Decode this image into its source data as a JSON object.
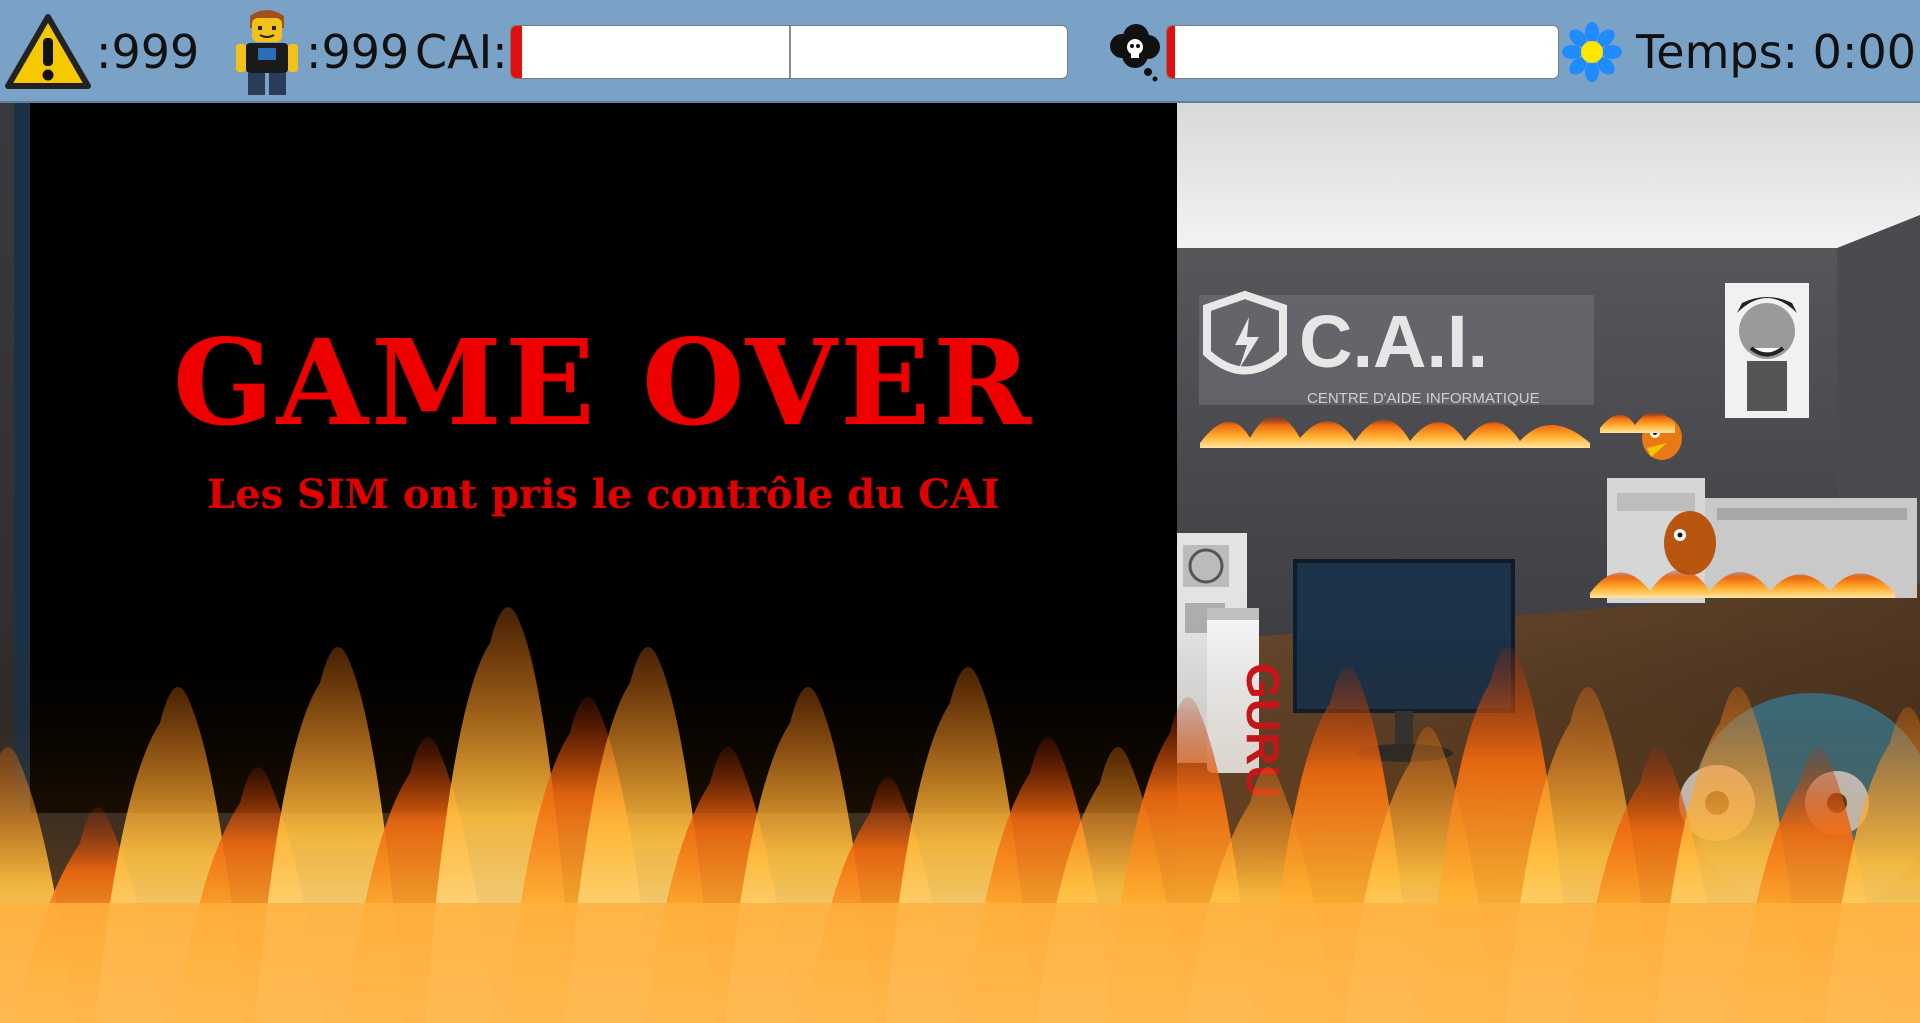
{
  "hud": {
    "alerts": {
      "icon": "warning-icon",
      "value": ":999"
    },
    "players": {
      "icon": "avatar-icon",
      "value": ":999"
    },
    "cai": {
      "label": "CAI:",
      "health_fraction": 0.02
    },
    "threat": {
      "icon": "skull-cloud-icon",
      "level_fraction": 0.02
    },
    "timer": {
      "icon": "flower-icon",
      "text": "Temps: 0:00"
    }
  },
  "game_over": {
    "title": "GAME OVER",
    "subtitle": "Les SIM ont pris le contrôle du CAI"
  },
  "scene": {
    "sign_text": "C.A.I.",
    "sign_subtext": "CENTRE D'AIDE INFORMATIQUE",
    "can_text": "GURU"
  },
  "colors": {
    "hud_bg": "#7aa2c7",
    "bar_fill": "#e01010",
    "game_over_red": "#ee0000",
    "wall": "#4b4b50",
    "fire": "#ff8a10"
  }
}
